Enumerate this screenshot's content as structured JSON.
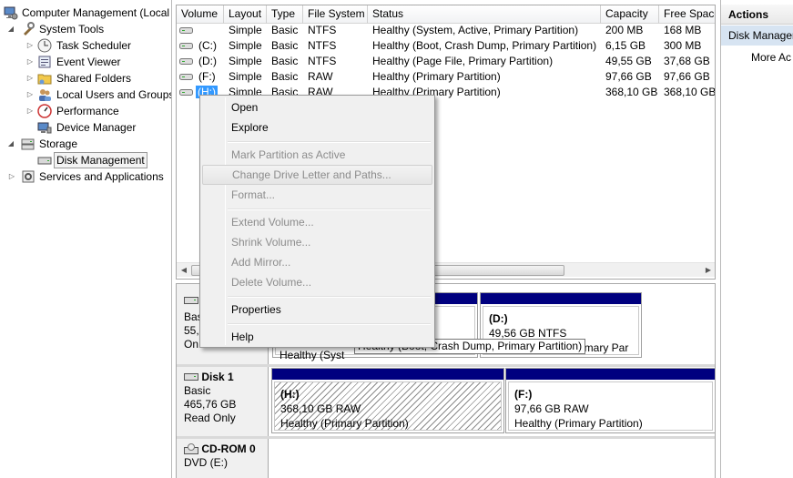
{
  "tree": {
    "root": "Computer Management (Local",
    "items": [
      {
        "label": "System Tools"
      },
      {
        "label": "Task Scheduler"
      },
      {
        "label": "Event Viewer"
      },
      {
        "label": "Shared Folders"
      },
      {
        "label": "Local Users and Groups"
      },
      {
        "label": "Performance"
      },
      {
        "label": "Device Manager"
      },
      {
        "label": "Storage"
      },
      {
        "label": "Disk Management"
      },
      {
        "label": "Services and Applications"
      }
    ]
  },
  "volume_list": {
    "columns": [
      "Volume",
      "Layout",
      "Type",
      "File System",
      "Status",
      "Capacity",
      "Free Space"
    ],
    "rows": [
      {
        "volume": "",
        "layout": "Simple",
        "type": "Basic",
        "fs": "NTFS",
        "status": "Healthy (System, Active, Primary Partition)",
        "capacity": "200 MB",
        "free": "168 MB"
      },
      {
        "volume": "(C:)",
        "layout": "Simple",
        "type": "Basic",
        "fs": "NTFS",
        "status": "Healthy (Boot, Crash Dump, Primary Partition)",
        "capacity": "6,15 GB",
        "free": "300 MB"
      },
      {
        "volume": "(D:)",
        "layout": "Simple",
        "type": "Basic",
        "fs": "NTFS",
        "status": "Healthy (Page File, Primary Partition)",
        "capacity": "49,55 GB",
        "free": "37,68 GB"
      },
      {
        "volume": "(F:)",
        "layout": "Simple",
        "type": "Basic",
        "fs": "RAW",
        "status": "Healthy (Primary Partition)",
        "capacity": "97,66 GB",
        "free": "97,66 GB"
      },
      {
        "volume": "(H:)",
        "layout": "Simple",
        "type": "Basic",
        "fs": "RAW",
        "status": "Healthy (Primary Partition)",
        "capacity": "368,10 GB",
        "free": "368,10 GB"
      }
    ]
  },
  "disks": {
    "disk0": {
      "label_partial": [
        "Basi",
        "55,9",
        "On"
      ],
      "c_status_partial": "Healthy (Syst",
      "d_name": "(D:)",
      "d_size": "49,56 GB NTFS",
      "d_status_partial": "Primary Par"
    },
    "disk1": {
      "name": "Disk 1",
      "type": "Basic",
      "size": "465,76 GB",
      "state": "Read Only",
      "h_name": "(H:)",
      "h_size": "368,10 GB RAW",
      "h_status": "Healthy (Primary Partition)",
      "f_name": "(F:)",
      "f_size": "97,66 GB RAW",
      "f_status": "Healthy (Primary Partition)"
    },
    "cdrom": {
      "name": "CD-ROM 0",
      "drive": "DVD (E:)"
    }
  },
  "tooltip": "Healthy (Boot, Crash Dump, Primary Partition)",
  "actions": {
    "title": "Actions",
    "section": "Disk Manager",
    "more": "More Ac"
  },
  "context_menu": {
    "open": "Open",
    "explore": "Explore",
    "mark_active": "Mark Partition as Active",
    "change_letter": "Change Drive Letter and Paths...",
    "format": "Format...",
    "extend": "Extend Volume...",
    "shrink": "Shrink Volume...",
    "add_mirror": "Add Mirror...",
    "delete": "Delete Volume...",
    "properties": "Properties",
    "help": "Help"
  },
  "colors": {
    "partition_bar": "#00007f",
    "selection": "#3399ff"
  }
}
